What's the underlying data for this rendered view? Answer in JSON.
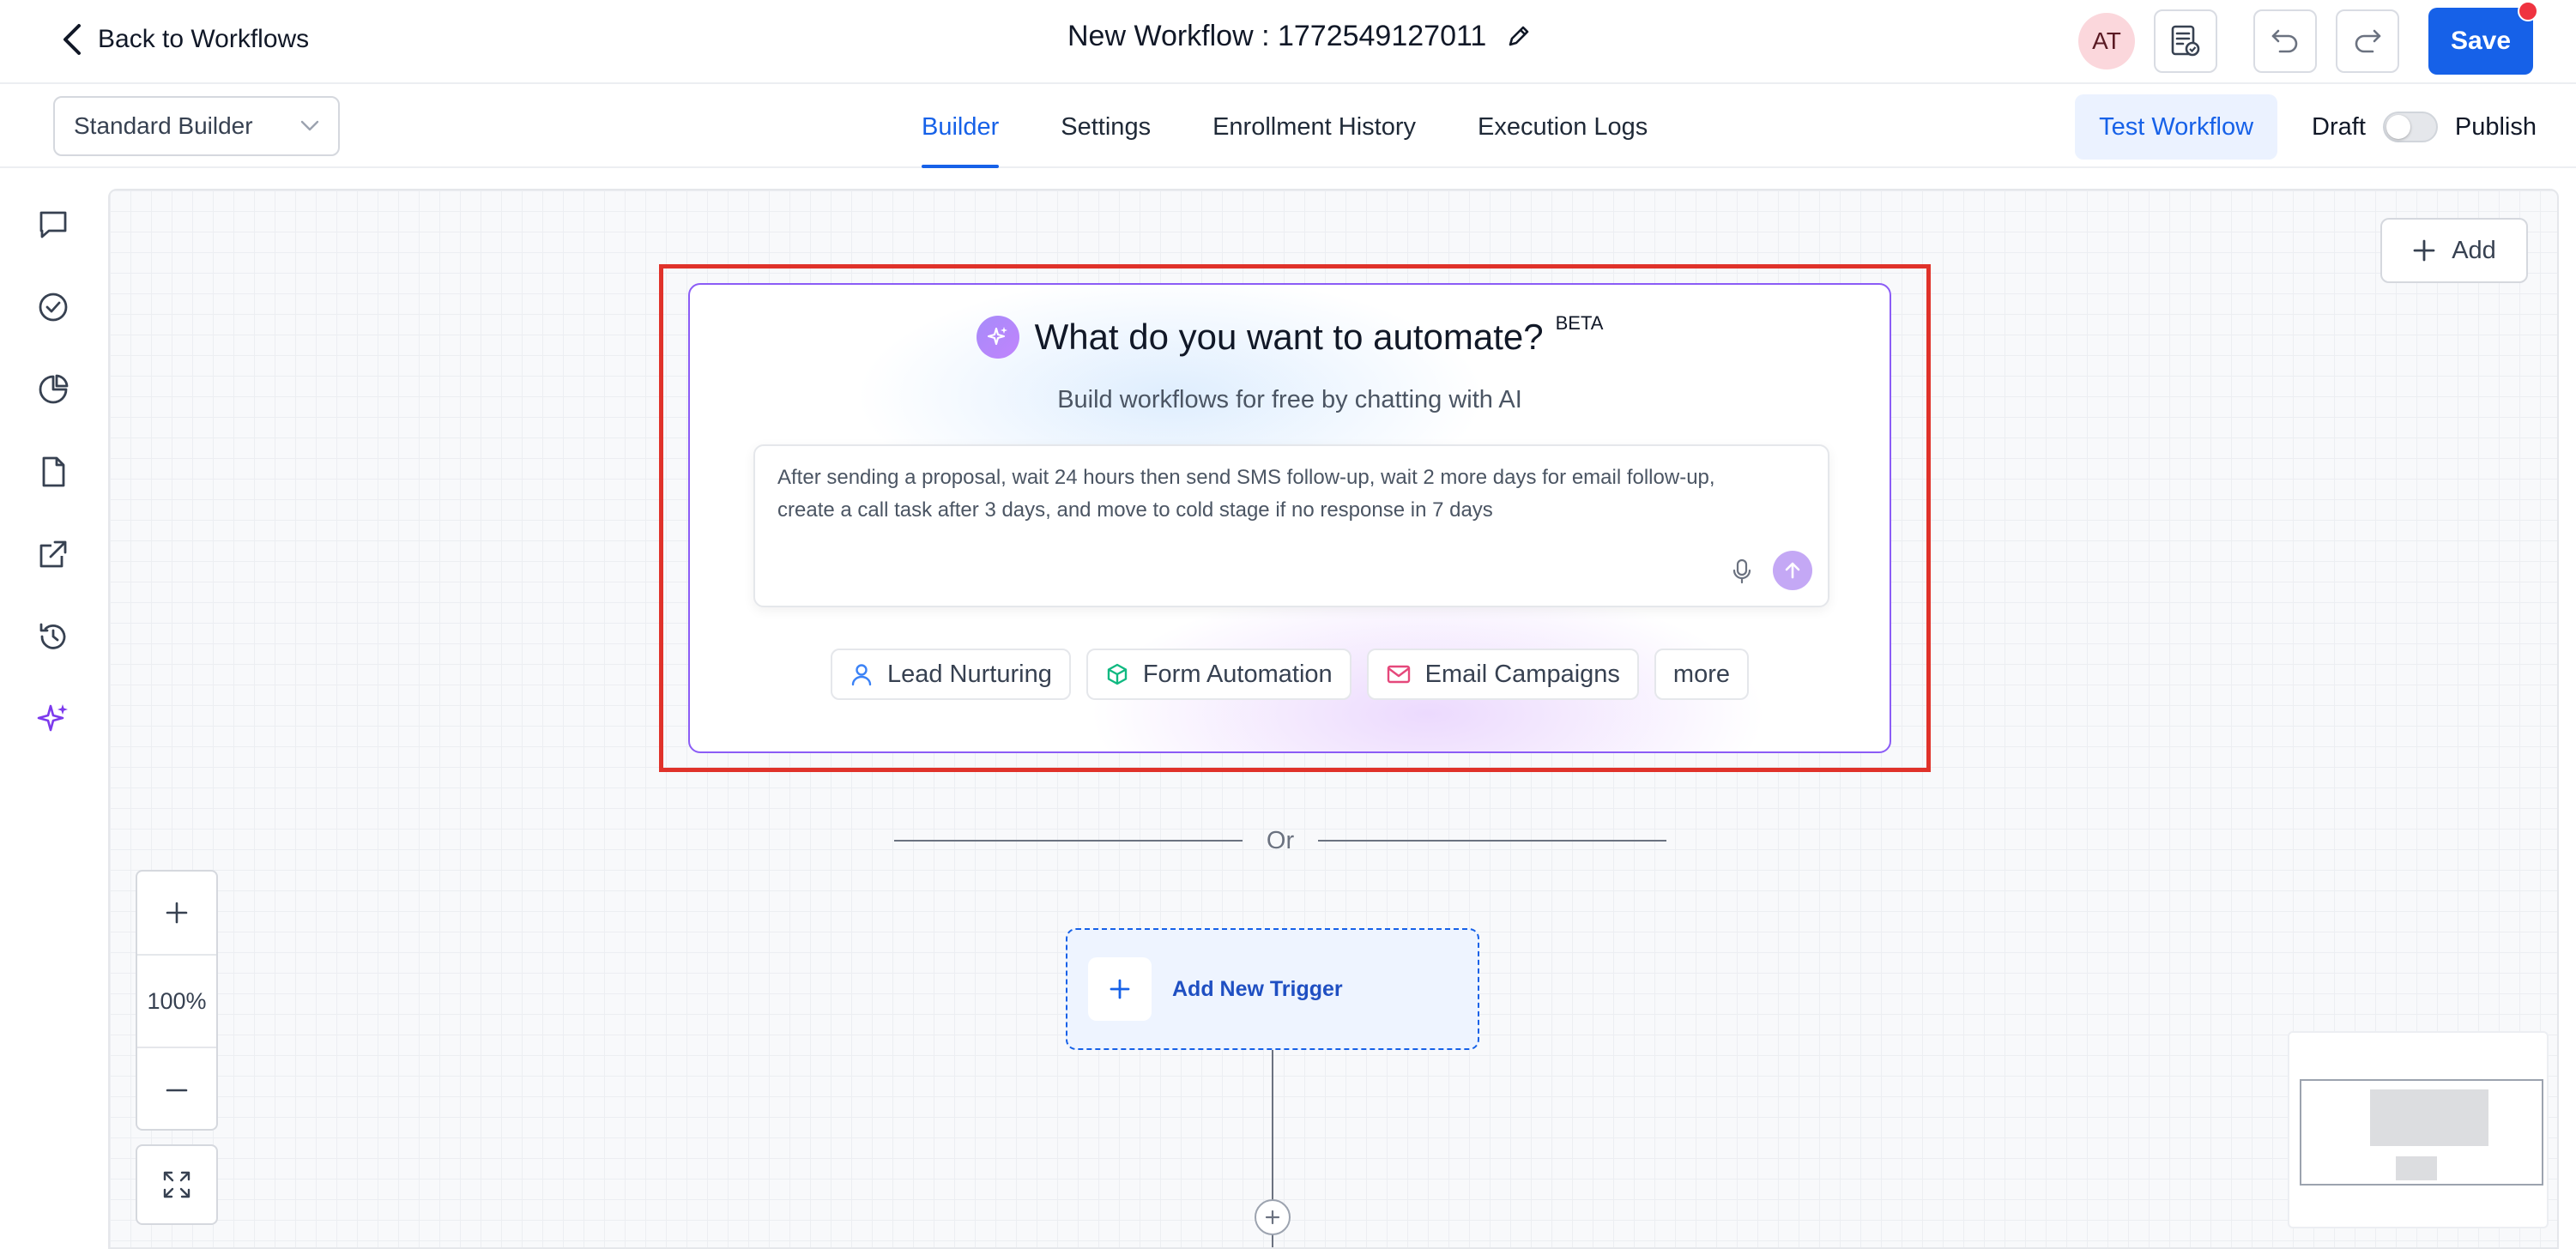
{
  "header": {
    "back_label": "Back to Workflows",
    "workflow_title": "New Workflow : 1772549127011",
    "avatar_initials": "AT",
    "save_label": "Save"
  },
  "subbar": {
    "builder_select": "Standard Builder",
    "tabs": [
      {
        "label": "Builder",
        "active": true
      },
      {
        "label": "Settings",
        "active": false
      },
      {
        "label": "Enrollment History",
        "active": false
      },
      {
        "label": "Execution Logs",
        "active": false
      }
    ],
    "test_label": "Test Workflow",
    "draft_label": "Draft",
    "publish_label": "Publish",
    "published": false
  },
  "rail": {
    "icons": [
      "chat-icon",
      "check-circle-icon",
      "pie-chart-icon",
      "document-icon",
      "external-link-icon",
      "history-icon",
      "sparkle-icon"
    ]
  },
  "canvas": {
    "add_label": "Add",
    "ai": {
      "title": "What do you want to automate?",
      "badge": "BETA",
      "subtitle": "Build workflows for free by chatting with AI",
      "prompt": "After sending a proposal, wait 24 hours then send SMS follow-up, wait 2 more days for email follow-up, create a call task after 3 days, and move to cold stage if no response in 7 days",
      "chips": [
        {
          "label": "Lead Nurturing",
          "icon": "user-icon"
        },
        {
          "label": "Form Automation",
          "icon": "cube-icon"
        },
        {
          "label": "Email Campaigns",
          "icon": "mail-icon"
        },
        {
          "label": "more",
          "icon": ""
        }
      ]
    },
    "or_label": "Or",
    "trigger_label": "Add New Trigger",
    "zoom_level": "100%"
  },
  "colors": {
    "primary": "#1661e8",
    "highlight": "#e0322a",
    "ai_border": "#8b5cf6",
    "rail_accent": "#7c3aed"
  }
}
